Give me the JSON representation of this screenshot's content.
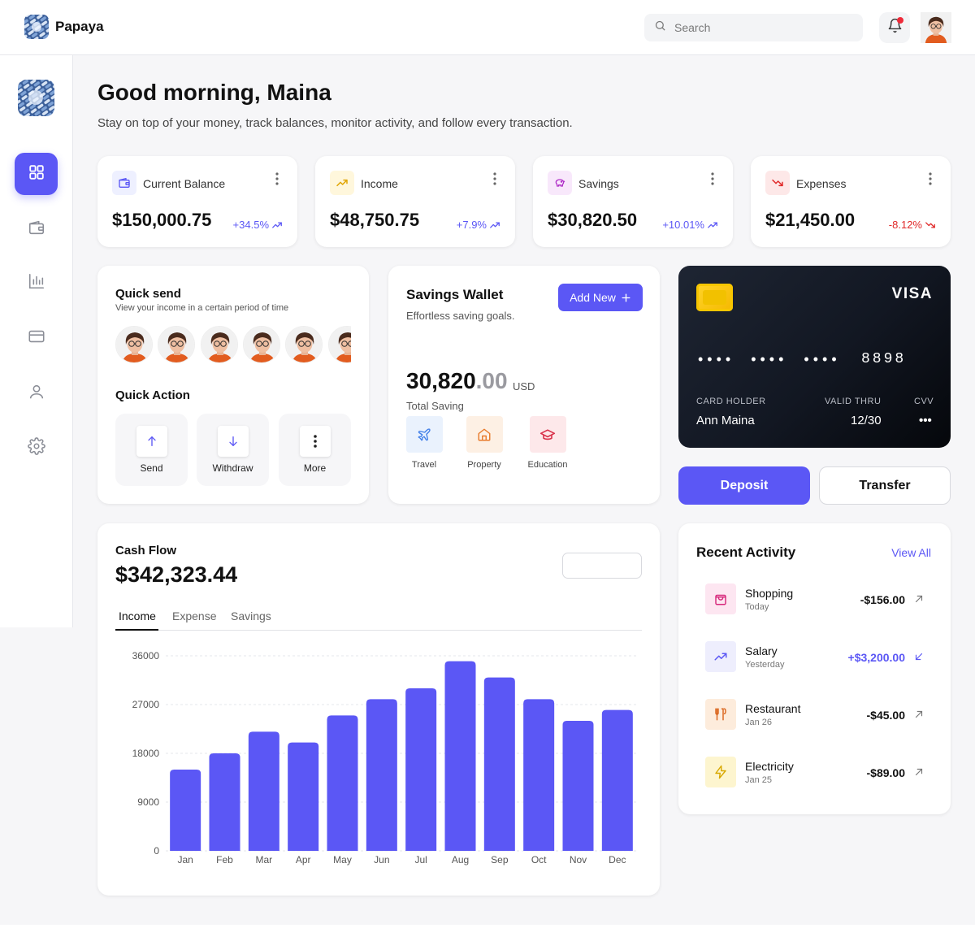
{
  "header": {
    "brand": "Papaya",
    "search_placeholder": "Search"
  },
  "greeting": {
    "title": "Good morning, Maina",
    "subtitle": "Stay on top of your money, track balances, monitor activity, and follow every transaction."
  },
  "stats": [
    {
      "label": "Current Balance",
      "value": "$150,000.75",
      "change": "+34.5%",
      "direction": "up",
      "icon": "wallet-icon",
      "accent": "#5b57f5"
    },
    {
      "label": "Income",
      "value": "$48,750.75",
      "change": "+7.9%",
      "direction": "up",
      "icon": "trending-up-icon",
      "accent": "#e0a400"
    },
    {
      "label": "Savings",
      "value": "$30,820.50",
      "change": "+10.01%",
      "direction": "up",
      "icon": "piggy-bank-icon",
      "accent": "#b030c8"
    },
    {
      "label": "Expenses",
      "value": "$21,450.00",
      "change": "-8.12%",
      "direction": "down",
      "icon": "trending-down-icon",
      "accent": "#e02a2a"
    }
  ],
  "quick_send": {
    "title": "Quick send",
    "subtitle": "View your income in a certain period of time"
  },
  "quick_action": {
    "title": "Quick Action",
    "actions": [
      {
        "label": "Send",
        "icon": "arrow-up-icon"
      },
      {
        "label": "Withdraw",
        "icon": "arrow-down-icon"
      },
      {
        "label": "More",
        "icon": "more-vertical-icon"
      }
    ]
  },
  "savings_wallet": {
    "title": "Savings Wallet",
    "subtitle": "Effortless saving goals.",
    "add_label": "Add New",
    "amount_main": "30,820",
    "amount_decimal": ".00",
    "currency": "USD",
    "total_label": "Total Saving",
    "goals": [
      {
        "label": "Travel",
        "icon": "airplane-icon"
      },
      {
        "label": "Property",
        "icon": "home-icon"
      },
      {
        "label": "Education",
        "icon": "graduation-cap-icon"
      }
    ]
  },
  "card": {
    "brand": "VISA",
    "masked": "•••• •••• ••••",
    "last4": "8898",
    "holder_label": "CARD HOLDER",
    "holder": "Ann Maina",
    "valid_label": "VALID THRU",
    "valid": "12/30",
    "cvv_label": "CVV",
    "cvv": "•••"
  },
  "actions": {
    "deposit": "Deposit",
    "transfer": "Transfer"
  },
  "cash_flow": {
    "title": "Cash Flow",
    "amount": "$342,323.44",
    "tabs": [
      "Income",
      "Expense",
      "Savings"
    ],
    "active_tab": "Income"
  },
  "chart_data": {
    "type": "bar",
    "title": "",
    "xlabel": "",
    "ylabel": "",
    "categories": [
      "Jan",
      "Feb",
      "Mar",
      "Apr",
      "May",
      "Jun",
      "Jul",
      "Aug",
      "Sep",
      "Oct",
      "Nov",
      "Dec"
    ],
    "values": [
      15000,
      18000,
      22000,
      20000,
      25000,
      28000,
      30000,
      35000,
      32000,
      28000,
      24000,
      26000
    ],
    "yticks": [
      "0",
      "9000",
      "18000",
      "27000",
      "36000"
    ],
    "ylim": [
      0,
      36000
    ],
    "grid": true,
    "color": "#5b57f5"
  },
  "recent_activity": {
    "title": "Recent Activity",
    "view_all": "View All",
    "items": [
      {
        "name": "Shopping",
        "date": "Today",
        "amount": "-$156.00",
        "icon": "shopping-bag-icon",
        "direction": "out"
      },
      {
        "name": "Salary",
        "date": "Yesterday",
        "amount": "+$3,200.00",
        "icon": "trending-up-icon",
        "direction": "in"
      },
      {
        "name": "Restaurant",
        "date": "Jan 26",
        "amount": "-$45.00",
        "icon": "utensils-icon",
        "direction": "out"
      },
      {
        "name": "Electricity",
        "date": "Jan 25",
        "amount": "-$89.00",
        "icon": "lightning-icon",
        "direction": "out"
      }
    ]
  }
}
